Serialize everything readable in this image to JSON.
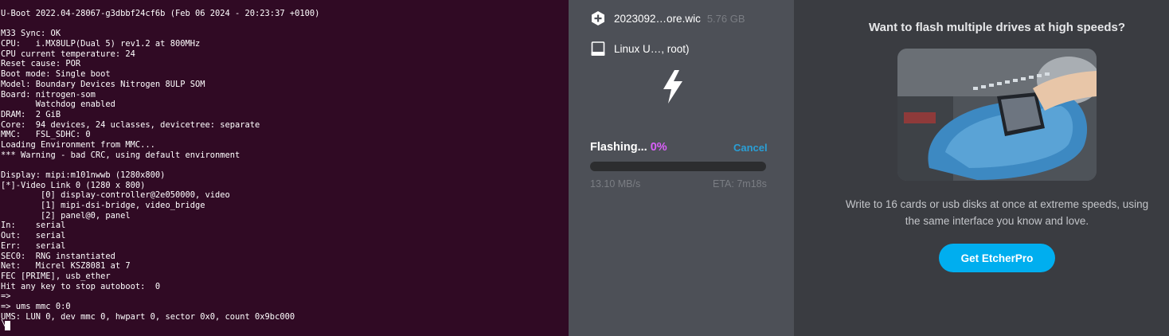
{
  "terminal": {
    "lines": [
      "U-Boot 2022.04-28067-g3dbbf24cf6b (Feb 06 2024 - 20:23:37 +0100)",
      "",
      "M33 Sync: OK",
      "CPU:   i.MX8ULP(Dual 5) rev1.2 at 800MHz",
      "CPU current temperature: 24",
      "Reset cause: POR",
      "Boot mode: Single boot",
      "Model: Boundary Devices Nitrogen 8ULP SOM",
      "Board: nitrogen-som",
      "       Watchdog enabled",
      "DRAM:  2 GiB",
      "Core:  94 devices, 24 uclasses, devicetree: separate",
      "MMC:   FSL_SDHC: 0",
      "Loading Environment from MMC...",
      "*** Warning - bad CRC, using default environment",
      "",
      "Display: mipi:m101nwwb (1280x800)",
      "[*]-Video Link 0 (1280 x 800)",
      "        [0] display-controller@2e050000, video",
      "        [1] mipi-dsi-bridge, video_bridge",
      "        [2] panel@0, panel",
      "In:    serial",
      "Out:   serial",
      "Err:   serial",
      "SEC0:  RNG instantiated",
      "Net:   Micrel KSZ8081 at 7",
      "FEC [PRIME], usb_ether",
      "Hit any key to stop autoboot:  0",
      "=>",
      "=> ums mmc 0:0",
      "UMS: LUN 0, dev mmc 0, hwpart 0, sector 0x0, count 0x9bc000"
    ],
    "prompt_char": "\\"
  },
  "flasher": {
    "image_name": "2023092…ore.wic",
    "image_size": "5.76 GB",
    "drive_name": "Linux U…, root)",
    "status_label": "Flashing...",
    "percent_text": "0%",
    "progress_fraction": 0.0,
    "cancel_label": "Cancel",
    "speed": "13.10 MB/s",
    "eta": "ETA: 7m18s",
    "icons": {
      "image": "plus-hexagon-icon",
      "drive": "drive-icon",
      "flash": "lightning-bolt-icon"
    }
  },
  "promo": {
    "title": "Want to flash multiple drives at high speeds?",
    "description": "Write to 16 cards or usb disks at once at extreme speeds, using the same interface you know and love.",
    "button_label": "Get EtcherPro"
  },
  "colors": {
    "terminal_bg": "#300a24",
    "accent_purple": "#da60f9",
    "link_blue": "#2a9fd6",
    "button_blue": "#00aeef"
  }
}
